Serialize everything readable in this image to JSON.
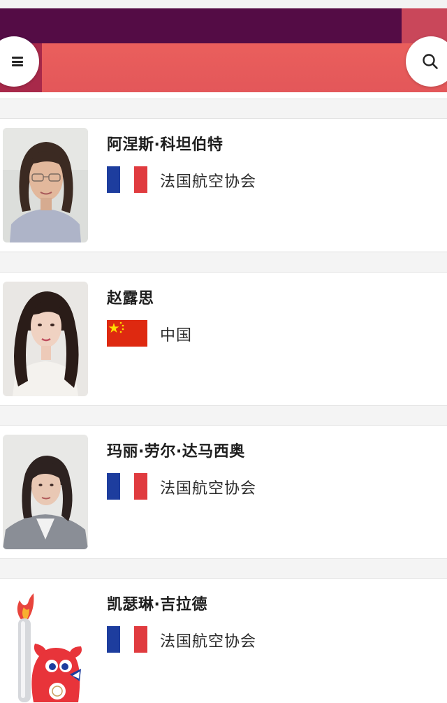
{
  "header": {
    "menu_icon": "hamburger-menu-icon",
    "search_icon": "search-icon",
    "colors": {
      "dark_band": "#540c45",
      "coral_band": "#e85b5b",
      "maroon_block": "#a8294a",
      "pink_block": "#c9475a"
    }
  },
  "people": [
    {
      "name": "阿涅斯·科坦伯特",
      "flag": "france-flag-icon",
      "organization": "法国航空协会"
    },
    {
      "name": "赵露思",
      "flag": "china-flag-icon",
      "organization": "中国"
    },
    {
      "name": "玛丽·劳尔·达马西奥",
      "flag": "france-flag-icon",
      "organization": "法国航空协会"
    },
    {
      "name": "凯瑟琳·吉拉德",
      "flag": "france-flag-icon",
      "organization": "法国航空协会"
    }
  ],
  "flag_colors": {
    "france": [
      "#1d3d9e",
      "#ffffff",
      "#e03b3f"
    ],
    "china_red": "#de2910",
    "china_star": "#ffde00"
  }
}
